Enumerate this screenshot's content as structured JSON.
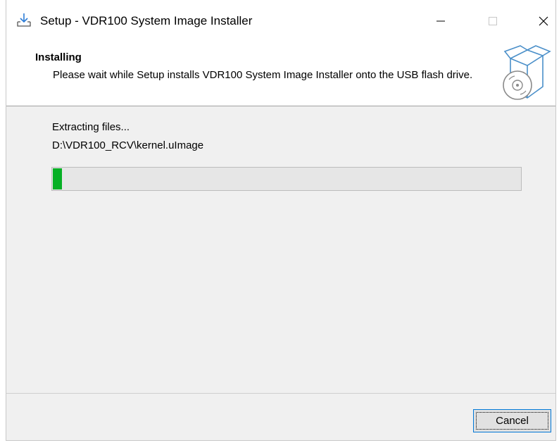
{
  "window": {
    "title": "Setup - VDR100 System Image Installer",
    "icons": {
      "app": "installer-download-icon",
      "minimize": "minimize-icon",
      "maximize": "maximize-icon",
      "close": "close-icon"
    }
  },
  "header": {
    "title": "Installing",
    "subtitle": "Please wait while Setup installs VDR100 System Image Installer onto the USB flash drive.",
    "icon": "box-disc-icon"
  },
  "progress": {
    "status_text": "Extracting files...",
    "current_file": "D:\\VDR100_RCV\\kernel.uImage",
    "percent": 2,
    "color": "#06b025"
  },
  "footer": {
    "cancel_label": "Cancel"
  }
}
